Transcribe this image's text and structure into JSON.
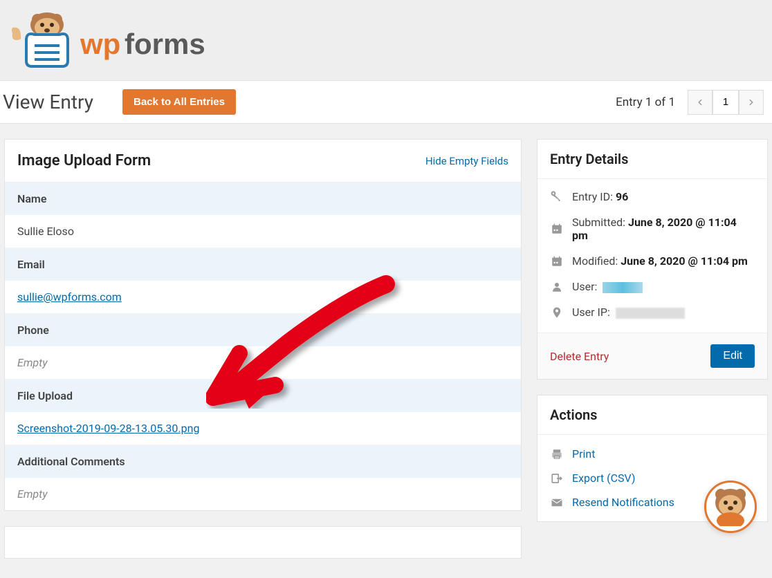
{
  "brand": "wpforms",
  "page_title": "View Entry",
  "back_button": "Back to All Entries",
  "entry_count_text": "Entry 1 of 1",
  "pager": {
    "current": "1"
  },
  "form_panel": {
    "title": "Image Upload Form",
    "hide_link": "Hide Empty Fields",
    "fields": {
      "name": {
        "label": "Name",
        "value": "Sullie Eloso"
      },
      "email": {
        "label": "Email",
        "value": "sullie@wpforms.com"
      },
      "phone": {
        "label": "Phone",
        "value": "Empty"
      },
      "file_upload": {
        "label": "File Upload",
        "value": "Screenshot-2019-09-28-13.05.30.png"
      },
      "additional_comments": {
        "label": "Additional Comments",
        "value": "Empty"
      }
    }
  },
  "entry_details": {
    "title": "Entry Details",
    "entry_id_label": "Entry ID:",
    "entry_id_value": "96",
    "submitted_label": "Submitted:",
    "submitted_value": "June 8, 2020 @ 11:04 pm",
    "modified_label": "Modified:",
    "modified_value": "June 8, 2020 @ 11:04 pm",
    "user_label": "User:",
    "user_ip_label": "User IP:",
    "delete_label": "Delete Entry",
    "edit_label": "Edit"
  },
  "actions": {
    "title": "Actions",
    "print": "Print",
    "export": "Export (CSV)",
    "resend": "Resend Notifications"
  }
}
